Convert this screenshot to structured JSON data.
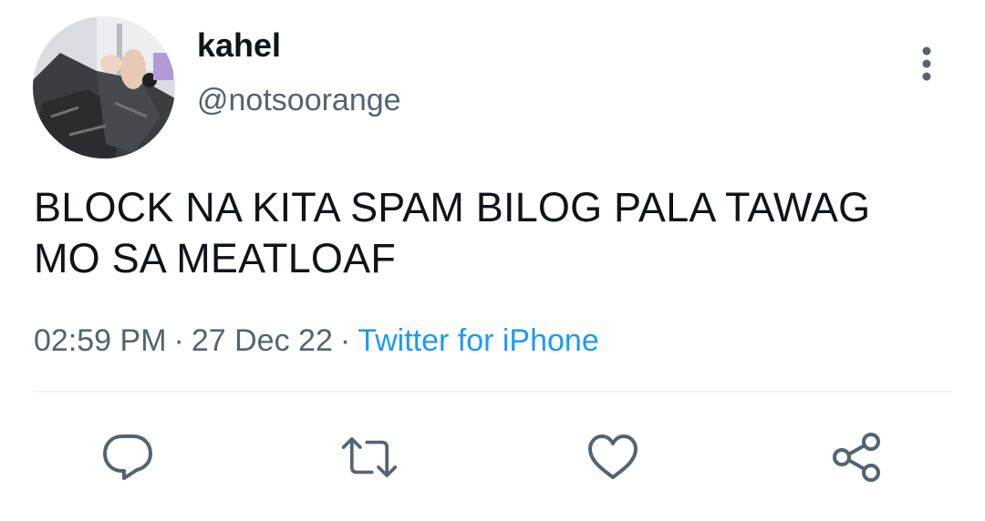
{
  "author": {
    "display_name": "kahel",
    "handle": "@notsoorange"
  },
  "tweet": {
    "text": "BLOCK NA KITA SPAM BILOG PALA TAWAG MO SA MEATLOAF"
  },
  "meta": {
    "time": "02:59 PM",
    "separator": "·",
    "date": "27 Dec 22",
    "source": "Twitter for iPhone"
  },
  "icons": {
    "more": "more-vertical-icon",
    "reply": "reply-icon",
    "retweet": "retweet-icon",
    "like": "heart-icon",
    "share": "share-icon"
  },
  "colors": {
    "text": "#0f1419",
    "secondary": "#536471",
    "link": "#1d9bf0",
    "divider": "#eff3f4"
  }
}
